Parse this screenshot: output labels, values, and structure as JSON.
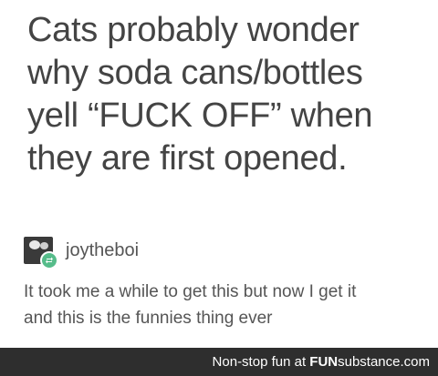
{
  "post": {
    "lines": [
      "Cats probably wonder",
      "why soda cans/bottles",
      "yell “FUCK OFF” when",
      "they are first opened."
    ]
  },
  "reply": {
    "username": "joytheboi",
    "avatar_icon": "user-avatar-icon",
    "badge_icon": "reblog-icon",
    "badge_color": "#56bc8a",
    "lines": [
      "It took me a while to get this but now I get it",
      "and this is the funnies thing ever"
    ]
  },
  "footer": {
    "tagline": "Non-stop fun at ",
    "brand_bold": "FUN",
    "brand_rest": "substance.com"
  }
}
